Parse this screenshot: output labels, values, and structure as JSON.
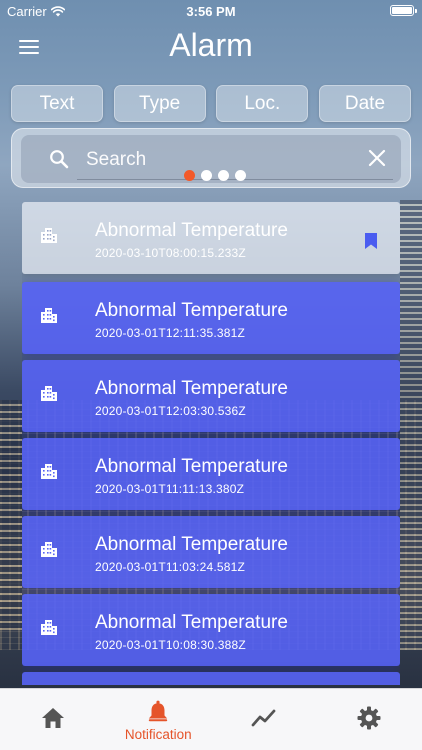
{
  "status_bar": {
    "carrier": "Carrier",
    "time": "3:56 PM",
    "battery_level": 1.0
  },
  "header": {
    "title": "Alarm",
    "menu_icon": "hamburger-menu-icon"
  },
  "filter_tabs": [
    {
      "label": "Text"
    },
    {
      "label": "Type"
    },
    {
      "label": "Loc."
    },
    {
      "label": "Date"
    }
  ],
  "search": {
    "placeholder": "Search",
    "value": "",
    "icon": "search-icon",
    "clear_icon": "close-icon"
  },
  "page_indicator": {
    "total": 4,
    "active_index": 0,
    "active_color": "#f2592a"
  },
  "alarms": [
    {
      "title": "Abnormal Temperature",
      "timestamp": "2020-03-10T08:00:15.233Z",
      "read": true,
      "bookmarked": true
    },
    {
      "title": "Abnormal Temperature",
      "timestamp": "2020-03-01T12:11:35.381Z",
      "read": false,
      "bookmarked": false
    },
    {
      "title": "Abnormal Temperature",
      "timestamp": "2020-03-01T12:03:30.536Z",
      "read": false,
      "bookmarked": false
    },
    {
      "title": "Abnormal Temperature",
      "timestamp": "2020-03-01T11:11:13.380Z",
      "read": false,
      "bookmarked": false
    },
    {
      "title": "Abnormal Temperature",
      "timestamp": "2020-03-01T11:03:24.581Z",
      "read": false,
      "bookmarked": false
    },
    {
      "title": "Abnormal Temperature",
      "timestamp": "2020-03-01T10:08:30.388Z",
      "read": false,
      "bookmarked": false
    }
  ],
  "colors": {
    "alarm_unread": "#5663f5",
    "bookmark": "#4a5cf0",
    "tab_active": "#e5542a",
    "tab_inactive": "#555555"
  },
  "tab_bar": {
    "items": [
      {
        "icon": "home-icon",
        "label": "",
        "active": false
      },
      {
        "icon": "bell-icon",
        "label": "Notification",
        "active": true
      },
      {
        "icon": "trend-chart-icon",
        "label": "",
        "active": false
      },
      {
        "icon": "gear-icon",
        "label": "",
        "active": false
      }
    ]
  }
}
